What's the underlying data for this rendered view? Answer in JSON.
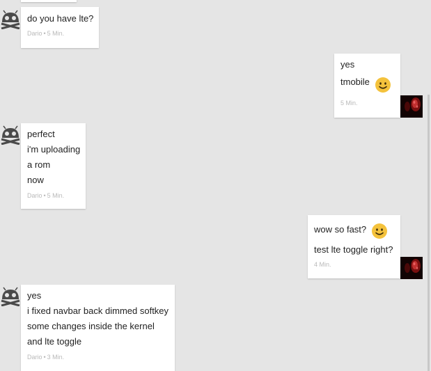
{
  "contact": {
    "name": "Dario",
    "avatar_icon": "android-skull-icon"
  },
  "me": {
    "avatar_icon": "red-face-photo-icon"
  },
  "messages": [
    {
      "from": "contact",
      "lines": [
        "do you have lte?"
      ],
      "sender": "Dario",
      "separator": "•",
      "time": "5 Min."
    },
    {
      "from": "me",
      "lines": [
        "yes",
        "tmobile"
      ],
      "emoji": "smiley-emoji",
      "time": "5 Min."
    },
    {
      "from": "contact",
      "lines": [
        "perfect",
        "i'm uploading",
        "a rom",
        "now"
      ],
      "sender": "Dario",
      "separator": "•",
      "time": "5 Min."
    },
    {
      "from": "me",
      "lines": [
        "wow so fast?",
        "test lte toggle right?"
      ],
      "emoji": "smiley-emoji",
      "time": "4 Min."
    },
    {
      "from": "contact",
      "lines": [
        "yes",
        "i fixed navbar back dimmed softkey",
        "some changes inside the kernel",
        "and lte toggle"
      ],
      "sender": "Dario",
      "separator": "•",
      "time": "3 Min."
    }
  ],
  "colors": {
    "background": "#e5e5e5",
    "bubble": "#ffffff",
    "meta_text": "#b9b9b9",
    "emoji_yellow": "#f4c23c"
  }
}
